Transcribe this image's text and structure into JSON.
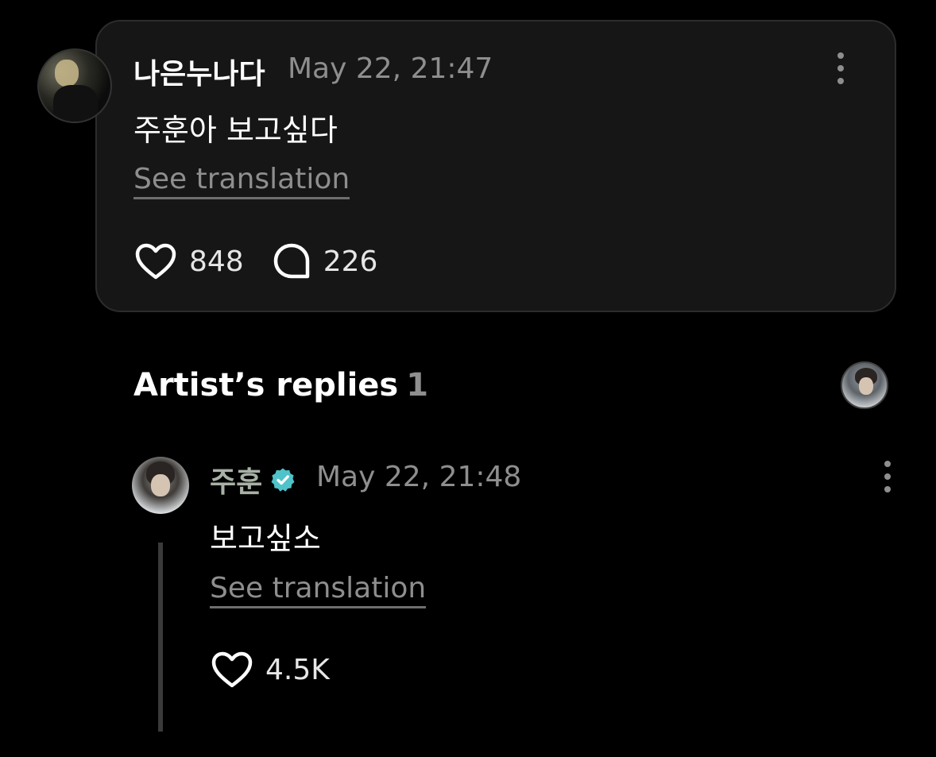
{
  "comment": {
    "author": "나은누나다",
    "timestamp": "May 22, 21:47",
    "text": "주훈아 보고싶다",
    "see_translation": "See translation",
    "likes": "848",
    "replies": "226"
  },
  "artist_replies": {
    "title": "Artist’s replies",
    "count": "1",
    "reply": {
      "author": "주훈",
      "verified": true,
      "timestamp": "May 22, 21:48",
      "text": "보고싶소",
      "see_translation": "See translation",
      "likes": "4.5K"
    }
  },
  "icons": {
    "like": "heart-icon",
    "reply": "speech-bubble-icon",
    "more": "vertical-dots-icon",
    "verified": "verified-badge-icon"
  },
  "colors": {
    "background": "#000000",
    "card": "#161616",
    "verified": "#4fc3c9",
    "muted_text": "#8e8e8e",
    "artist_name": "#a7b1a5"
  }
}
